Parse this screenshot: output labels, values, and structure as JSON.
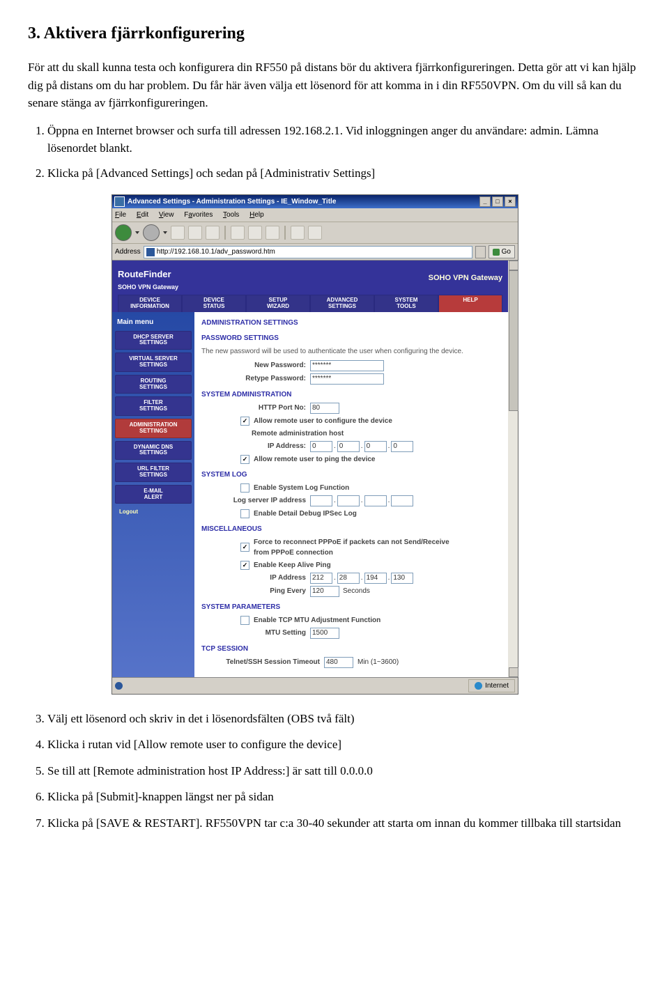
{
  "doc": {
    "heading": "3. Aktivera fjärrkonfigurering",
    "intro1": "För att du skall kunna testa och konfigurera din RF550 på distans bör du aktivera fjärrkonfigureringen. Detta gör att vi kan hjälp dig på distans om du har problem. Du får här även välja ett lösenord för att komma in i din RF550VPN. Om du vill så kan du senare stänga av fjärrkonfigureringen.",
    "step1": "Öppna en Internet browser och surfa till adressen 192.168.2.1. Vid inloggningen anger du användare: admin. Lämna lösenordet blankt.",
    "step2": "Klicka på [Advanced Settings] och sedan på [Administrativ Settings]",
    "step3": "Välj ett lösenord och skriv in det i lösenordsfälten (OBS två fält)",
    "step4": "Klicka i rutan vid [Allow remote user to configure the device]",
    "step5": "Se till att [Remote administration host IP Address:] är satt till 0.0.0.0",
    "step6": "Klicka på [Submit]-knappen längst ner på sidan",
    "step7": "Klicka på  [SAVE & RESTART]. RF550VPN tar c:a 30-40 sekunder att starta om innan du kommer tillbaka till startsidan"
  },
  "browser": {
    "title": "Advanced Settings - Administration Settings - IE_Window_Title",
    "menu": {
      "file": "File",
      "edit": "Edit",
      "view": "View",
      "favorites": "Favorites",
      "tools": "Tools",
      "help": "Help"
    },
    "address_label": "Address",
    "address_value": "http://192.168.10.1/adv_password.htm",
    "go": "Go",
    "status_zone": "Internet"
  },
  "rf": {
    "logo1": "Route",
    "logo2": "Finder",
    "soho1": "SOHO VPN",
    "soho2": "Gateway",
    "tagline": "SOHO VPN Gateway",
    "nav": [
      "DEVICE\nINFORMATION",
      "DEVICE\nSTATUS",
      "SETUP\nWIZARD",
      "ADVANCED\nSETTINGS",
      "SYSTEM\nTOOLS",
      "HELP"
    ],
    "mainmenu": "Main menu",
    "side": [
      "DHCP SERVER\nSETTINGS",
      "VIRTUAL SERVER\nSETTINGS",
      "ROUTING\nSETTINGS",
      "FILTER\nSETTINGS",
      "ADMINISTRATION\nSETTINGS",
      "DYNAMIC DNS\nSETTINGS",
      "URL FILTER\nSETTINGS",
      "E-MAIL\nALERT",
      "Logout"
    ],
    "sect_admin": "ADMINISTRATION SETTINGS",
    "sect_pw": "PASSWORD SETTINGS",
    "pw_desc": "The new password will be used to authenticate the user when configuring the device.",
    "lbl_newpw": "New Password:",
    "lbl_repw": "Retype Password:",
    "val_pw": "*******",
    "sect_sysadmin": "SYSTEM ADMINISTRATION",
    "lbl_port": "HTTP Port No:",
    "val_port": "80",
    "chk_remote_conf": "Allow remote user to configure the device",
    "lbl_remote_host": "Remote administration host",
    "lbl_ipaddr": "IP Address:",
    "ip_remote": [
      "0",
      "0",
      "0",
      "0"
    ],
    "chk_remote_ping": "Allow remote user to ping the device",
    "sect_syslog": "SYSTEM LOG",
    "chk_syslog": "Enable System Log Function",
    "lbl_syslog_ip": "Log server IP address",
    "chk_ipsec": "Enable Detail Debug IPSec Log",
    "sect_misc": "MISCELLANEOUS",
    "chk_pppoe": "Force to reconnect PPPoE if packets can not Send/Receive from PPPoE connection",
    "chk_keepalive": "Enable Keep Alive Ping",
    "lbl_ip2": "IP Address",
    "ip_keep": [
      "212",
      "28",
      "194",
      "130"
    ],
    "lbl_pingevery": "Ping Every",
    "val_pingevery": "120",
    "lbl_seconds": "Seconds",
    "sect_sysparam": "SYSTEM PARAMETERS",
    "chk_mtu": "Enable TCP MTU Adjustment Function",
    "lbl_mtu": "MTU Setting",
    "val_mtu": "1500",
    "sect_tcp": "TCP SESSION",
    "lbl_telnet": "Telnet/SSH Session Timeout",
    "val_telnet": "480",
    "lbl_min": "Min (1~3600)"
  }
}
